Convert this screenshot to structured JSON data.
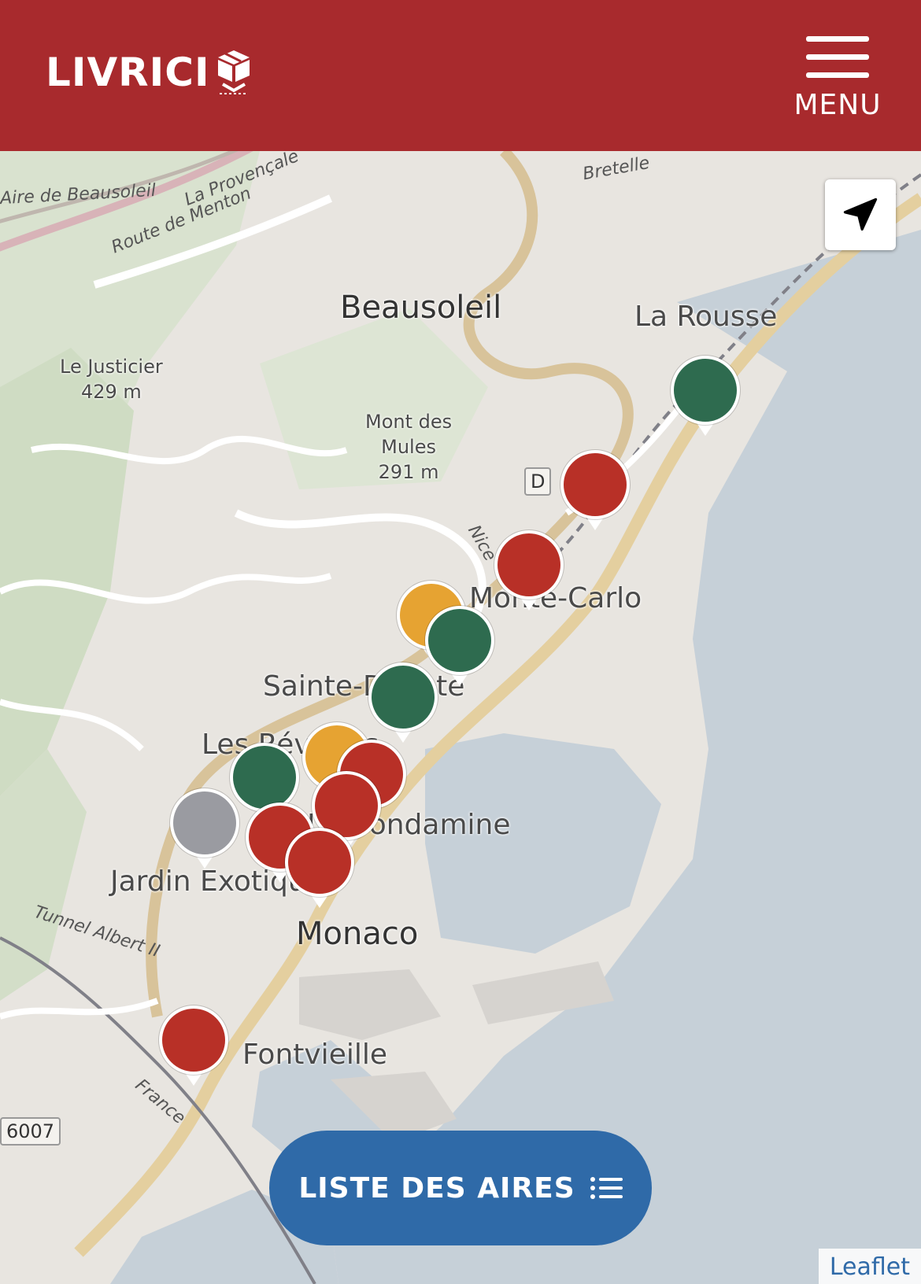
{
  "header": {
    "logo_text": "LIVRICI",
    "menu_label": "MENU",
    "background_color": "#a82a2d"
  },
  "map": {
    "places": {
      "beausoleil": "Beausoleil",
      "la_rousse": "La Rousse",
      "le_justicier": "Le Justicier",
      "le_justicier_elev": "429 m",
      "mont_des_mules_1": "Mont des",
      "mont_des_mules_2": "Mules",
      "mont_des_mules_elev": "291 m",
      "monte_carlo": "Monte-Carlo",
      "sainte_devote": "Sainte-Dévote",
      "les_revoires": "Les Révoires",
      "condamine": "La Condamine",
      "jardin_exotique": "Jardin Exotique",
      "monaco": "Monaco",
      "fontvieille": "Fontvieille"
    },
    "roads": {
      "aire_de_beausoleil": "Aire de Beausoleil",
      "la_provencale": "La Provençale",
      "route_de_menton": "Route de Menton",
      "bretelle": "Bretelle",
      "nice": "Nice",
      "tunnel_albert": "Tunnel Albert II",
      "france": "France"
    },
    "shields": {
      "d_route": "D",
      "route_6007": "6007"
    },
    "marker_colors": {
      "green": "#2e6b4f",
      "red": "#b83027",
      "orange": "#e6a332",
      "grey": "#9a9ba1"
    },
    "markers": [
      {
        "color": "green"
      },
      {
        "color": "red"
      },
      {
        "color": "red"
      },
      {
        "color": "orange"
      },
      {
        "color": "green"
      },
      {
        "color": "green"
      },
      {
        "color": "orange"
      },
      {
        "color": "green"
      },
      {
        "color": "red"
      },
      {
        "color": "grey"
      },
      {
        "color": "red"
      },
      {
        "color": "red"
      },
      {
        "color": "red"
      },
      {
        "color": "red"
      }
    ]
  },
  "locate_button": {
    "icon": "navigation-arrow-icon"
  },
  "list_button": {
    "label": "LISTE DES AIRES",
    "icon": "list-icon",
    "color": "#2f6aa8"
  },
  "attribution": {
    "link_text": "Leaflet"
  }
}
